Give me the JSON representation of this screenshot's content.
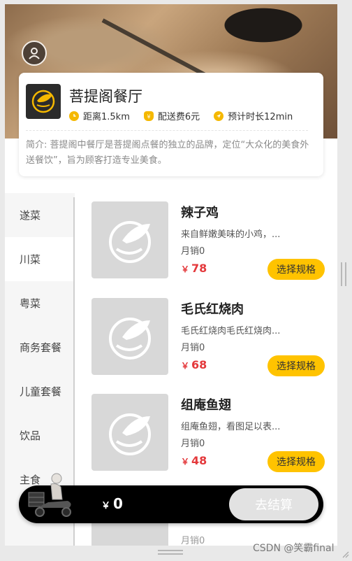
{
  "shop": {
    "name": "菩提阁餐厅",
    "distance": "距离1.5km",
    "delivery_fee": "配送费6元",
    "eta": "预计时长12min",
    "description": "简介: 菩提阁中餐厅是菩提阁点餐的独立的品牌，定位“大众化的美食外送餐饮”，旨为顾客打造专业美食。"
  },
  "categories": [
    {
      "label": "遂菜",
      "active": false
    },
    {
      "label": "川菜",
      "active": true
    },
    {
      "label": "粤菜",
      "active": false
    },
    {
      "label": "商务套餐",
      "active": false
    },
    {
      "label": "儿童套餐",
      "active": false
    },
    {
      "label": "饮品",
      "active": false
    },
    {
      "label": "主食",
      "active": false
    }
  ],
  "dishes": [
    {
      "name": "辣子鸡",
      "desc": "来自鲜嫩美味的小鸡，...",
      "sales": "月销0",
      "currency": "￥",
      "price": "78",
      "button": "选择规格"
    },
    {
      "name": "毛氏红烧肉",
      "desc": "毛氏红烧肉毛氏红烧肉...",
      "sales": "月销0",
      "currency": "￥",
      "price": "68",
      "button": "选择规格"
    },
    {
      "name": "组庵鱼翅",
      "desc": "组庵鱼翅，看图足以表...",
      "sales": "月销0",
      "currency": "￥",
      "price": "48",
      "button": "选择规格"
    }
  ],
  "partial_dish": {
    "sales": "月销0"
  },
  "cart": {
    "currency": "￥",
    "total": "0",
    "checkout": "去结算"
  },
  "watermark": "CSDN @笑霸final",
  "colors": {
    "accent": "#ffc300",
    "price": "#e4393c",
    "cart_bar": "#000000",
    "checkout_disabled": "#e2e2e2"
  },
  "icons": {
    "avatar": "user-icon",
    "distance": "clock-icon",
    "fee": "money-bag-icon",
    "eta": "navigation-arrow-icon",
    "dish_placeholder": "bowl-leaf-icon",
    "cart": "delivery-rider-icon"
  }
}
